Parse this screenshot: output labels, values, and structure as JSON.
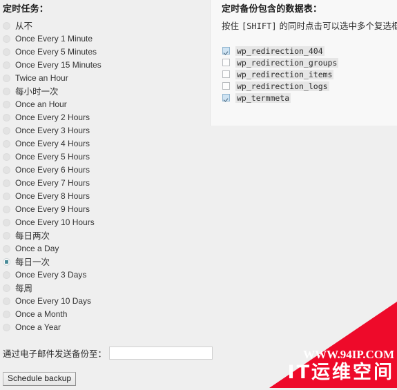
{
  "colors": {
    "page_background": "#efefef",
    "panel_background": "#f8f8f8",
    "radio_selected": "#4a8c99",
    "checkbox_checked": "#cfe3f2",
    "watermark_red": "#ee0a2a",
    "text": "#2b2b2b"
  },
  "schedule": {
    "heading": "定时任务：",
    "selected_index": 17,
    "options": [
      {
        "label": "从不",
        "cjk": true,
        "checked": false
      },
      {
        "label": "Once Every 1 Minute",
        "cjk": false,
        "checked": false
      },
      {
        "label": "Once Every 5 Minutes",
        "cjk": false,
        "checked": false
      },
      {
        "label": "Once Every 15 Minutes",
        "cjk": false,
        "checked": false
      },
      {
        "label": "Twice an Hour",
        "cjk": false,
        "checked": false
      },
      {
        "label": "每小时一次",
        "cjk": true,
        "checked": false
      },
      {
        "label": "Once an Hour",
        "cjk": false,
        "checked": false
      },
      {
        "label": "Once Every 2 Hours",
        "cjk": false,
        "checked": false
      },
      {
        "label": "Once Every 3 Hours",
        "cjk": false,
        "checked": false
      },
      {
        "label": "Once Every 4 Hours",
        "cjk": false,
        "checked": false
      },
      {
        "label": "Once Every 5 Hours",
        "cjk": false,
        "checked": false
      },
      {
        "label": "Once Every 6 Hours",
        "cjk": false,
        "checked": false
      },
      {
        "label": "Once Every 7 Hours",
        "cjk": false,
        "checked": false
      },
      {
        "label": "Once Every 8 Hours",
        "cjk": false,
        "checked": false
      },
      {
        "label": "Once Every 9 Hours",
        "cjk": false,
        "checked": false
      },
      {
        "label": "Once Every 10 Hours",
        "cjk": false,
        "checked": false
      },
      {
        "label": "每日两次",
        "cjk": true,
        "checked": false
      },
      {
        "label": "Once a Day",
        "cjk": false,
        "checked": false
      },
      {
        "label": "每日一次",
        "cjk": true,
        "checked": true
      },
      {
        "label": "Once Every 3 Days",
        "cjk": false,
        "checked": false
      },
      {
        "label": "每周",
        "cjk": true,
        "checked": false
      },
      {
        "label": "Once Every 10 Days",
        "cjk": false,
        "checked": false
      },
      {
        "label": "Once a Month",
        "cjk": false,
        "checked": false
      },
      {
        "label": "Once a Year",
        "cjk": false,
        "checked": false
      }
    ]
  },
  "tables": {
    "heading": "定时备份包含的数据表：",
    "hint_prefix": "按住 ",
    "hint_key": "[SHIFT]",
    "hint_suffix": " 的同时点击可以选中多个复选框",
    "items": [
      {
        "name": "wp_redirection_404",
        "checked": true
      },
      {
        "name": "wp_redirection_groups",
        "checked": false
      },
      {
        "name": "wp_redirection_items",
        "checked": false
      },
      {
        "name": "wp_redirection_logs",
        "checked": false
      },
      {
        "name": "wp_termmeta",
        "checked": true
      }
    ]
  },
  "email": {
    "label": "通过电子邮件发送备份至：",
    "value": "",
    "placeholder": ""
  },
  "actions": {
    "schedule_backup_label": "Schedule backup"
  },
  "watermark": {
    "url": "WWW.94IP.COM",
    "brand": "IT运维空间"
  }
}
